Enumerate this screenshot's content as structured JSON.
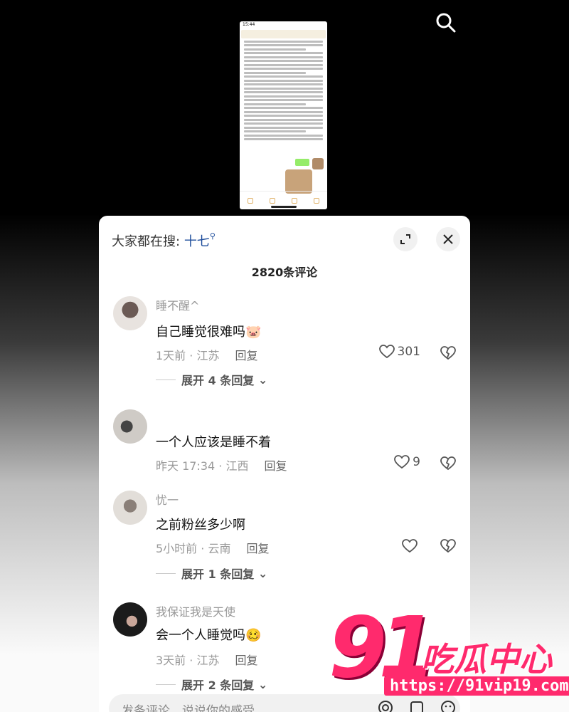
{
  "header": {
    "search_prefix": "大家都在搜:",
    "search_term": "十七",
    "comment_count": "2820条评论"
  },
  "thumbnail": {
    "status_time": "15:44"
  },
  "comments": [
    {
      "username": "睡不醒^",
      "text": "自己睡觉很难吗",
      "emoji": "🐷",
      "time_location": "1天前 · 江苏",
      "reply_label": "回复",
      "likes": "301",
      "expand_label": "展开 4 条回复"
    },
    {
      "username": "",
      "text": "一个人应该是睡不着",
      "time_location": "昨天 17:34 · 江西",
      "reply_label": "回复",
      "likes": "9"
    },
    {
      "username": "忧一",
      "text": "之前粉丝多少啊",
      "time_location": "5小时前 · 云南",
      "reply_label": "回复",
      "likes": "",
      "expand_label": "展开 1 条回复"
    },
    {
      "username": "我保证我是天使",
      "text": "会一个人睡觉吗",
      "emoji": "🥴",
      "time_location": "3天前 · 江苏",
      "reply_label": "回复",
      "expand_label": "展开 2 条回复"
    }
  ],
  "input": {
    "placeholder": "发条评论，说说你的感受"
  },
  "watermark": {
    "number": "91",
    "brand": "吃瓜中心",
    "url": "https://91vip19.com"
  },
  "colors": {
    "accent_link": "#1f4e9c",
    "watermark": "#ff2a6d"
  }
}
